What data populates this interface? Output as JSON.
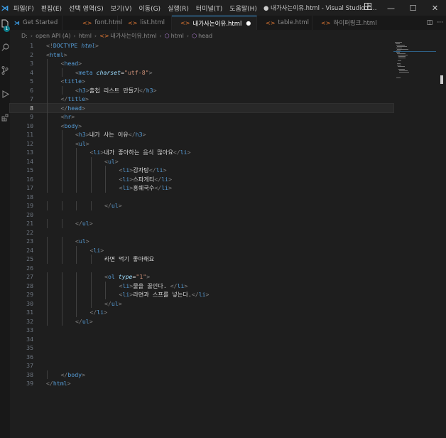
{
  "titlebar": {
    "menu": [
      "파일(F)",
      "편집(E)",
      "선택 영역(S)",
      "보기(V)",
      "이동(G)",
      "실행(R)",
      "터미널(T)",
      "도움말(H)"
    ],
    "window_title": "● 내가사는이유.html - Visual Studio C..."
  },
  "activity": {
    "badge": "1"
  },
  "tabs": [
    {
      "label": "Get Started",
      "kind": "vs",
      "active": false
    },
    {
      "label": "font.html",
      "kind": "html",
      "active": false
    },
    {
      "label": "list.html",
      "kind": "html",
      "active": false
    },
    {
      "label": "내가사는이유.html",
      "kind": "html",
      "active": true,
      "dirty": "●"
    },
    {
      "label": "table.html",
      "kind": "html",
      "active": false
    },
    {
      "label": "하이퍼링크.html",
      "kind": "html",
      "active": false
    }
  ],
  "breadcrumb": [
    "D:",
    "open API (A)",
    "html",
    "내가사는이유.html",
    "html",
    "head"
  ],
  "editor": {
    "current_line": 8,
    "lines": [
      {
        "n": "1",
        "i": 0,
        "parts": [
          [
            "p",
            "<!"
          ],
          [
            "t",
            "DOCTYPE"
          ],
          [
            "x",
            " "
          ],
          [
            "k",
            "html"
          ],
          [
            "p",
            ">"
          ]
        ]
      },
      {
        "n": "2",
        "i": 0,
        "parts": [
          [
            "p",
            "<"
          ],
          [
            "t",
            "html"
          ],
          [
            "p",
            ">"
          ]
        ]
      },
      {
        "n": "3",
        "i": 1,
        "parts": [
          [
            "p",
            "<"
          ],
          [
            "t",
            "head"
          ],
          [
            "p",
            ">"
          ]
        ]
      },
      {
        "n": "4",
        "i": 2,
        "parts": [
          [
            "p",
            "<"
          ],
          [
            "t",
            "meta"
          ],
          [
            "x",
            " "
          ],
          [
            "a",
            "charset"
          ],
          [
            "x",
            "="
          ],
          [
            "s",
            "\"utf-8\""
          ],
          [
            "p",
            ">"
          ]
        ]
      },
      {
        "n": "5",
        "i": 1,
        "parts": [
          [
            "p",
            "<"
          ],
          [
            "t",
            "title"
          ],
          [
            "p",
            ">"
          ]
        ]
      },
      {
        "n": "6",
        "i": 2,
        "parts": [
          [
            "p",
            "<"
          ],
          [
            "t",
            "h3"
          ],
          [
            "p",
            ">"
          ],
          [
            "x",
            "출첩 리스트 만들기"
          ],
          [
            "p",
            "</"
          ],
          [
            "t",
            "h3"
          ],
          [
            "p",
            ">"
          ]
        ]
      },
      {
        "n": "7",
        "i": 1,
        "parts": [
          [
            "p",
            "</"
          ],
          [
            "t",
            "title"
          ],
          [
            "p",
            ">"
          ]
        ]
      },
      {
        "n": "8",
        "i": 1,
        "parts": [
          [
            "p",
            "</"
          ],
          [
            "t",
            "head"
          ],
          [
            "p",
            ">"
          ]
        ]
      },
      {
        "n": "9",
        "i": 1,
        "parts": [
          [
            "p",
            "<"
          ],
          [
            "t",
            "hr"
          ],
          [
            "p",
            ">"
          ]
        ]
      },
      {
        "n": "10",
        "i": 1,
        "parts": [
          [
            "p",
            "<"
          ],
          [
            "t",
            "body"
          ],
          [
            "p",
            ">"
          ]
        ]
      },
      {
        "n": "11",
        "i": 2,
        "parts": [
          [
            "p",
            "<"
          ],
          [
            "t",
            "h3"
          ],
          [
            "p",
            ">"
          ],
          [
            "x",
            "내가 사는 이유"
          ],
          [
            "p",
            "</"
          ],
          [
            "t",
            "h3"
          ],
          [
            "p",
            ">"
          ]
        ]
      },
      {
        "n": "12",
        "i": 2,
        "parts": [
          [
            "p",
            "<"
          ],
          [
            "t",
            "ul"
          ],
          [
            "p",
            ">"
          ]
        ]
      },
      {
        "n": "13",
        "i": 3,
        "parts": [
          [
            "p",
            "<"
          ],
          [
            "t",
            "li"
          ],
          [
            "p",
            ">"
          ],
          [
            "x",
            "내가 좋아하는 음식 많아요"
          ],
          [
            "p",
            "</"
          ],
          [
            "t",
            "li"
          ],
          [
            "p",
            ">"
          ]
        ]
      },
      {
        "n": "14",
        "i": 4,
        "parts": [
          [
            "p",
            "<"
          ],
          [
            "t",
            "ul"
          ],
          [
            "p",
            ">"
          ]
        ]
      },
      {
        "n": "15",
        "i": 5,
        "parts": [
          [
            "p",
            "<"
          ],
          [
            "t",
            "li"
          ],
          [
            "p",
            ">"
          ],
          [
            "x",
            "감자탕"
          ],
          [
            "p",
            "</"
          ],
          [
            "t",
            "li"
          ],
          [
            "p",
            ">"
          ]
        ]
      },
      {
        "n": "16",
        "i": 5,
        "parts": [
          [
            "p",
            "<"
          ],
          [
            "t",
            "li"
          ],
          [
            "p",
            ">"
          ],
          [
            "x",
            "스파게티"
          ],
          [
            "p",
            "</"
          ],
          [
            "t",
            "li"
          ],
          [
            "p",
            ">"
          ]
        ]
      },
      {
        "n": "17",
        "i": 5,
        "parts": [
          [
            "p",
            "<"
          ],
          [
            "t",
            "li"
          ],
          [
            "p",
            ">"
          ],
          [
            "x",
            "홍쉐국수"
          ],
          [
            "p",
            "</"
          ],
          [
            "t",
            "li"
          ],
          [
            "p",
            ">"
          ]
        ]
      },
      {
        "n": "18",
        "i": 0,
        "parts": []
      },
      {
        "n": "19",
        "i": 4,
        "parts": [
          [
            "p",
            "</"
          ],
          [
            "t",
            "ul"
          ],
          [
            "p",
            ">"
          ]
        ]
      },
      {
        "n": "20",
        "i": 0,
        "parts": []
      },
      {
        "n": "21",
        "i": 2,
        "parts": [
          [
            "p",
            "</"
          ],
          [
            "t",
            "ul"
          ],
          [
            "p",
            ">"
          ]
        ]
      },
      {
        "n": "22",
        "i": 0,
        "parts": []
      },
      {
        "n": "23",
        "i": 2,
        "parts": [
          [
            "p",
            "<"
          ],
          [
            "t",
            "ul"
          ],
          [
            "p",
            ">"
          ]
        ]
      },
      {
        "n": "24",
        "i": 3,
        "parts": [
          [
            "p",
            "<"
          ],
          [
            "t",
            "li"
          ],
          [
            "p",
            ">"
          ]
        ]
      },
      {
        "n": "25",
        "i": 4,
        "parts": [
          [
            "x",
            "라면 먹기 좋아해요"
          ]
        ]
      },
      {
        "n": "26",
        "i": 0,
        "parts": []
      },
      {
        "n": "27",
        "i": 4,
        "parts": [
          [
            "p",
            "<"
          ],
          [
            "t",
            "ol"
          ],
          [
            "x",
            " "
          ],
          [
            "a",
            "type"
          ],
          [
            "x",
            "="
          ],
          [
            "s",
            "\"1\""
          ],
          [
            "p",
            ">"
          ]
        ]
      },
      {
        "n": "28",
        "i": 5,
        "parts": [
          [
            "p",
            "<"
          ],
          [
            "t",
            "li"
          ],
          [
            "p",
            ">"
          ],
          [
            "x",
            "물을 끓인다. "
          ],
          [
            "p",
            "</"
          ],
          [
            "t",
            "li"
          ],
          [
            "p",
            ">"
          ]
        ]
      },
      {
        "n": "29",
        "i": 5,
        "parts": [
          [
            "p",
            "<"
          ],
          [
            "t",
            "li"
          ],
          [
            "p",
            ">"
          ],
          [
            "x",
            "라면과 스프를 넣는다."
          ],
          [
            "p",
            "</"
          ],
          [
            "t",
            "li"
          ],
          [
            "p",
            ">"
          ]
        ]
      },
      {
        "n": "30",
        "i": 4,
        "parts": [
          [
            "p",
            "</"
          ],
          [
            "t",
            "ul"
          ],
          [
            "p",
            ">"
          ]
        ]
      },
      {
        "n": "31",
        "i": 3,
        "parts": [
          [
            "p",
            "</"
          ],
          [
            "t",
            "li"
          ],
          [
            "p",
            ">"
          ]
        ]
      },
      {
        "n": "32",
        "i": 2,
        "parts": [
          [
            "p",
            "</"
          ],
          [
            "t",
            "ul"
          ],
          [
            "p",
            ">"
          ]
        ]
      },
      {
        "n": "33",
        "i": 0,
        "parts": []
      },
      {
        "n": "34",
        "i": 0,
        "parts": []
      },
      {
        "n": "35",
        "i": 0,
        "parts": []
      },
      {
        "n": "36",
        "i": 0,
        "parts": []
      },
      {
        "n": "37",
        "i": 0,
        "parts": []
      },
      {
        "n": "38",
        "i": 1,
        "parts": [
          [
            "p",
            "</"
          ],
          [
            "t",
            "body"
          ],
          [
            "p",
            ">"
          ]
        ]
      },
      {
        "n": "39",
        "i": 0,
        "parts": [
          [
            "p",
            "</"
          ],
          [
            "t",
            "html"
          ],
          [
            "p",
            ">"
          ]
        ]
      }
    ]
  },
  "colors": {
    "accent": "#3ea4f0",
    "tag": "#569cd6",
    "attr": "#9cdcfe",
    "string": "#ce9178",
    "html_icon": "#e37933"
  }
}
